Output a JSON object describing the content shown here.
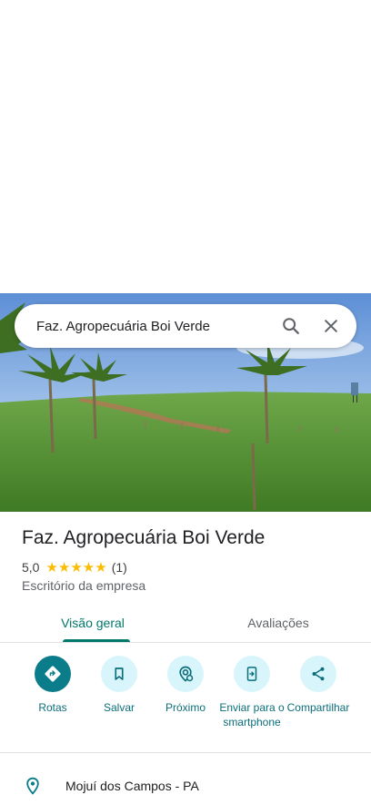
{
  "search": {
    "query": "Faz. Agropecuária Boi Verde"
  },
  "place": {
    "name": "Faz. Agropecuária Boi Verde",
    "rating": "5,0",
    "stars": "★★★★★",
    "review_count": "(1)",
    "category": "Escritório da empresa"
  },
  "tabs": [
    {
      "label": "Visão geral",
      "active": true
    },
    {
      "label": "Avaliações",
      "active": false
    }
  ],
  "actions": [
    {
      "label": "Rotas",
      "icon": "directions-icon"
    },
    {
      "label": "Salvar",
      "icon": "bookmark-icon"
    },
    {
      "label": "Próximo",
      "icon": "nearby-icon"
    },
    {
      "label": "Enviar para o smartphone",
      "icon": "send-to-phone-icon"
    },
    {
      "label": "Compartilhar",
      "icon": "share-icon"
    }
  ],
  "address": {
    "text": "Mojuí dos Campos - PA",
    "icon": "pin-icon"
  },
  "colors": {
    "accent": "#00796b",
    "action_bg": "#d8f5fb",
    "primary_action": "#0b7d8a",
    "star": "#fbbc04"
  }
}
